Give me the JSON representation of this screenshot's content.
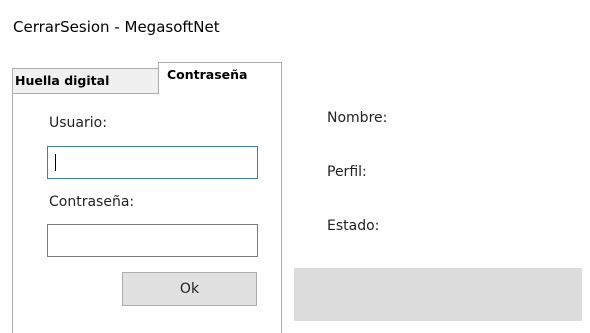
{
  "window": {
    "title": "CerrarSesion - MegasoftNet"
  },
  "tabs": [
    {
      "label": "Huella digital",
      "selected": false
    },
    {
      "label": "Contraseña",
      "selected": true
    }
  ],
  "login_form": {
    "user_label": "Usuario:",
    "user_value": "",
    "password_label": "Contraseña:",
    "password_value": "",
    "ok_label": "Ok"
  },
  "info": {
    "nombre_label": "Nombre:",
    "perfil_label": "Perfil:",
    "estado_label": "Estado:"
  },
  "colors": {
    "focus_border": "#3c7fb1",
    "button_bg": "#e1e1e1",
    "panel_grey": "#dcdcdc"
  }
}
